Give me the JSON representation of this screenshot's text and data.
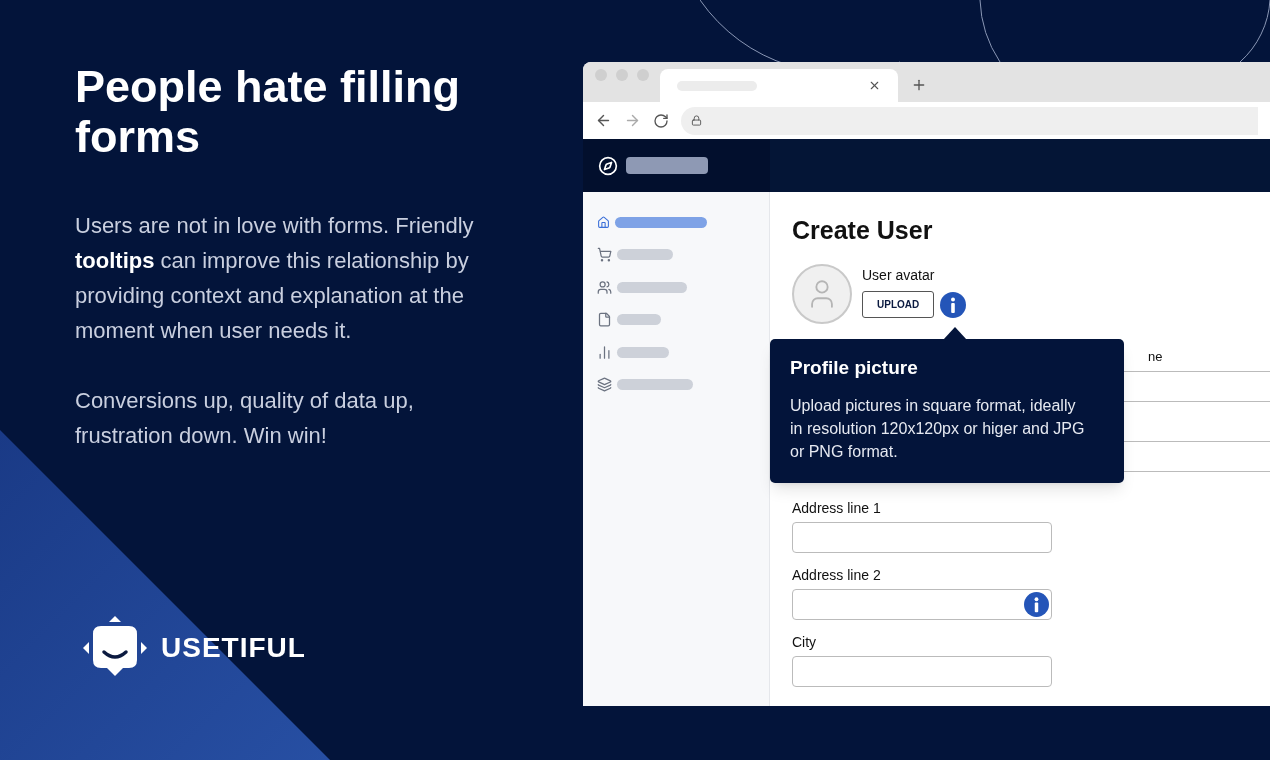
{
  "hero": {
    "headline": "People hate filling forms",
    "paragraphs": [
      "Users are not in love with forms. Friendly **tooltips** can improve this relationship by providing context and explanation at the moment when user needs it.",
      "Conversions up, quality of data up, frustration down. Win win!"
    ]
  },
  "logo": {
    "name": "USETIFUL"
  },
  "sidebar": {
    "items": [
      {
        "kind": "home",
        "selected": true
      },
      {
        "kind": "cart",
        "selected": false
      },
      {
        "kind": "users",
        "selected": false
      },
      {
        "kind": "file",
        "selected": false
      },
      {
        "kind": "chart",
        "selected": false
      },
      {
        "kind": "layers",
        "selected": false
      }
    ]
  },
  "page": {
    "title": "Create User",
    "avatar_label": "User avatar",
    "upload_button": "UPLOAD",
    "tooltip": {
      "title": "Profile picture",
      "body": "Upload pictures in square format, ideally in resolution 120x120px or higer and JPG or PNG format."
    },
    "partial_label": "ne",
    "fields": [
      {
        "label": "Address line 1",
        "info": false
      },
      {
        "label": "Address line 2",
        "info": true
      },
      {
        "label": "City",
        "info": false
      }
    ]
  }
}
